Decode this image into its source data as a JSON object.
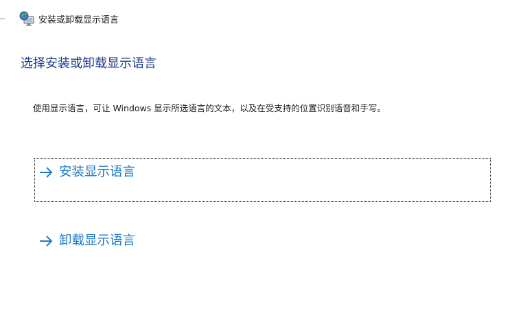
{
  "window": {
    "title": "安装或卸载显示语言",
    "icon": "globe-monitor-icon"
  },
  "main": {
    "heading": "选择安装或卸载显示语言",
    "description": "使用显示语言，可让 Windows 显示所选语言的文本，以及在受支持的位置识别语音和手写。",
    "options": [
      {
        "label": "安装显示语言",
        "icon": "arrow-right-icon",
        "focused": true
      },
      {
        "label": "卸载显示语言",
        "icon": "arrow-right-icon",
        "focused": false
      }
    ]
  },
  "colors": {
    "heading": "#1e3c91",
    "link": "#1e7ac8",
    "text": "#1a1a1a",
    "background": "#ffffff"
  }
}
